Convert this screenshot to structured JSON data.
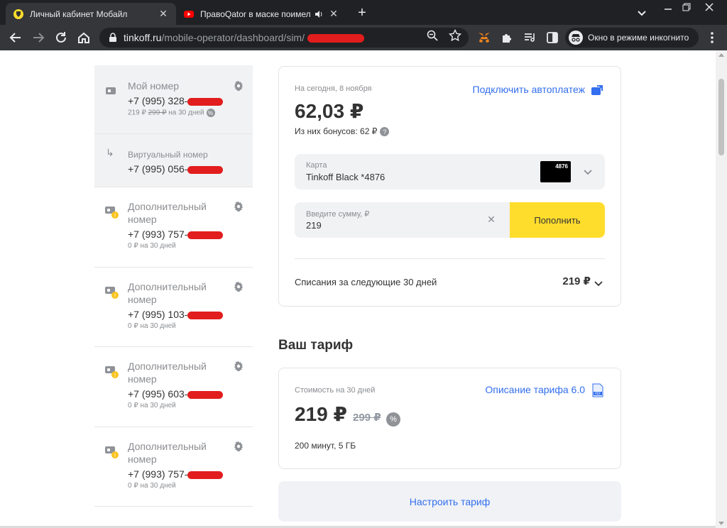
{
  "browser": {
    "tabs": [
      {
        "title": "Личный кабинет Мобайл",
        "active": true
      },
      {
        "title": "ПравоQator в маске поимел П",
        "active": false
      }
    ],
    "url_host": "tinkoff.ru",
    "url_path": "/mobile-operator/dashboard/sim/",
    "incognito_label": "Окно в режиме инкогнито"
  },
  "sidebar": {
    "sims": [
      {
        "label": "Мой номер",
        "phone": "+7 (995) 328-",
        "price_new": "219 ₽",
        "price_old": "299 ₽",
        "period": "на 30 дней",
        "type": "main"
      },
      {
        "label": "Виртуальный номер",
        "phone": "+7 (995) 056-",
        "type": "virtual"
      },
      {
        "label": "Дополнительный номер",
        "phone": "+7 (993) 757-",
        "price": "0 ₽ на 30 дней",
        "type": "additional"
      },
      {
        "label": "Дополнительный номер",
        "phone": "+7 (995) 103-",
        "price": "0 ₽ на 30 дней",
        "type": "additional"
      },
      {
        "label": "Дополнительный номер",
        "phone": "+7 (995) 603-",
        "price": "0 ₽ на 30 дней",
        "type": "additional"
      },
      {
        "label": "Дополнительный номер",
        "phone": "+7 (993) 757-",
        "price": "0 ₽ на 30 дней",
        "type": "additional"
      }
    ]
  },
  "balance": {
    "date": "На сегодня, 8 ноября",
    "autopay": "Подключить автоплатеж",
    "sum": "62,03 ₽",
    "bonus": "Из них бонусов: 62 ₽",
    "card_label": "Карта",
    "card_value": "Tinkoff Black *4876",
    "card_last": "4876",
    "amount_label": "Введите сумму, ₽",
    "amount_value": "219",
    "topup_button": "Пополнить",
    "charges_label": "Списания за следующие 30 дней",
    "charges_sum": "219 ₽"
  },
  "tariff": {
    "title": "Ваш тариф",
    "cost_label": "Стоимость на 30 дней",
    "description_link": "Описание тарифа 6.0",
    "price": "219 ₽",
    "old_price": "299 ₽",
    "minutes": "200 минут, 5 ГБ",
    "configure_button": "Настроить тариф"
  },
  "colors": {
    "accent": "#336fee",
    "yellow": "#ffdd2d",
    "redaction": "#e21d1d"
  }
}
